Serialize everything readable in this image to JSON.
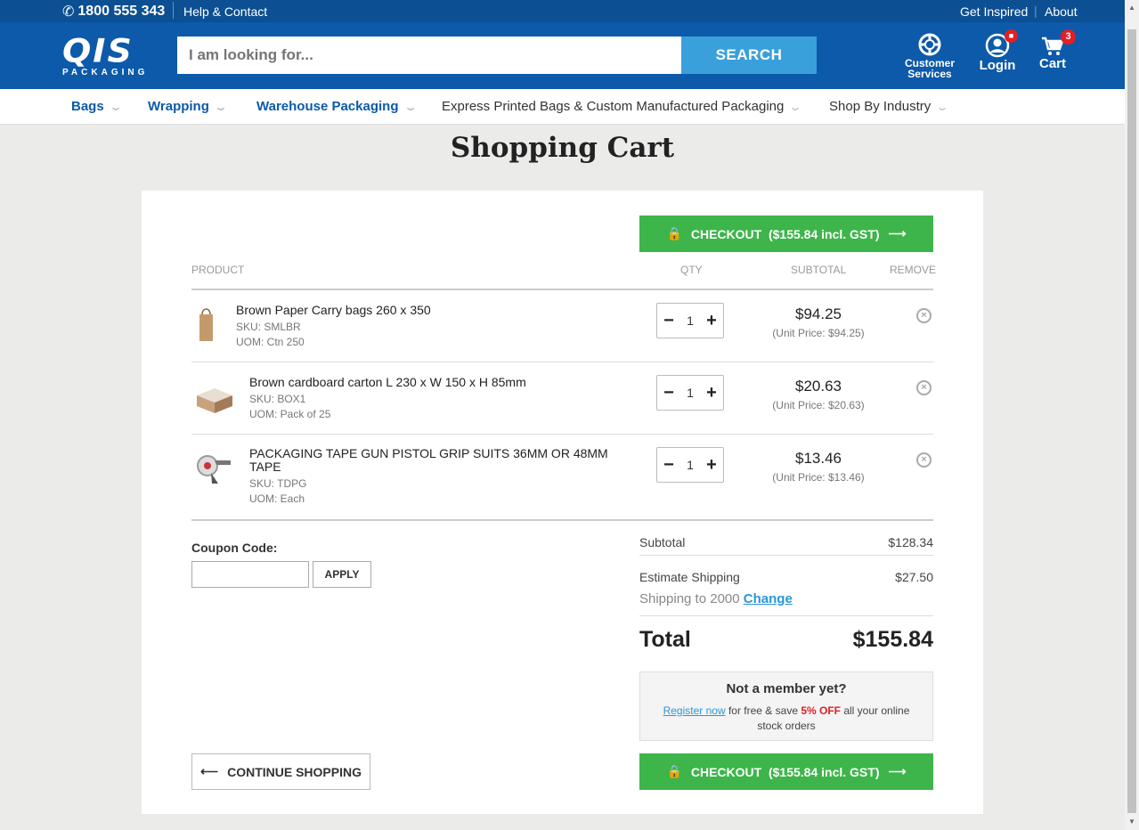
{
  "topbar": {
    "phone": "1800 555 343",
    "help": "Help & Contact",
    "inspired": "Get Inspired",
    "about": "About"
  },
  "header": {
    "logo_big": "QIS",
    "logo_small": "PACKAGING",
    "search_placeholder": "I am looking for...",
    "search_button": "SEARCH",
    "customer_services": "Customer Services",
    "login": "Login",
    "cart": "Cart",
    "cart_count": "3"
  },
  "nav": [
    {
      "label": "Bags"
    },
    {
      "label": "Wrapping"
    },
    {
      "label": "Warehouse Packaging"
    },
    {
      "label": "Express Printed Bags & Custom Manufactured Packaging"
    },
    {
      "label": "Shop By Industry"
    }
  ],
  "page_title": "Shopping Cart",
  "checkout_label": "CHECKOUT  ($155.84 incl. GST)",
  "columns": {
    "product": "PRODUCT",
    "qty": "QTY",
    "subtotal": "SUBTOTAL",
    "remove": "REMOVE"
  },
  "items": [
    {
      "name": "Brown Paper Carry bags 260 x 350",
      "sku": "SKU: SMLBR",
      "uom": "UOM: Ctn 250",
      "qty": "1",
      "price": "$94.25",
      "unit": "(Unit Price: $94.25)"
    },
    {
      "name": "Brown cardboard carton L 230 x W 150 x H 85mm",
      "sku": "SKU: BOX1",
      "uom": "UOM: Pack of 25",
      "qty": "1",
      "price": "$20.63",
      "unit": "(Unit Price: $20.63)"
    },
    {
      "name": "PACKAGING TAPE GUN PISTOL GRIP SUITS 36MM OR 48MM TAPE",
      "sku": "SKU: TDPG",
      "uom": "UOM: Each",
      "qty": "1",
      "price": "$13.46",
      "unit": "(Unit Price: $13.46)"
    }
  ],
  "coupon": {
    "label": "Coupon Code:",
    "apply": "APPLY"
  },
  "summary": {
    "subtotal_label": "Subtotal",
    "subtotal": "$128.34",
    "shipping_label": "Estimate Shipping",
    "shipping": "$27.50",
    "shipping_to": "Shipping to 2000",
    "change": "Change",
    "total_label": "Total",
    "total": "$155.84"
  },
  "member": {
    "title": "Not a member yet?",
    "register": "Register now",
    "mid": " for free & save ",
    "off": "5% OFF",
    "tail": " all your online stock orders"
  },
  "continue_label": "CONTINUE SHOPPING",
  "colors": {
    "topbar": "#0c4f93",
    "header": "#0c5aa9",
    "search_button": "#39a0dc",
    "checkout": "#3db54a",
    "badge": "#e31e24"
  }
}
